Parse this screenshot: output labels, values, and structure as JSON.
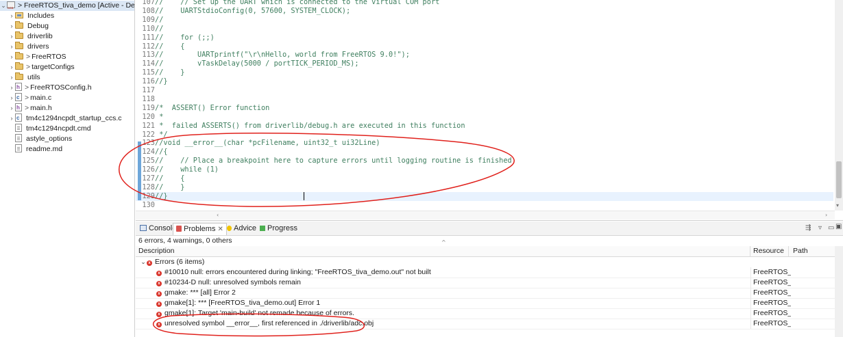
{
  "explorer": {
    "project": {
      "label": "> FreeRTOS_tiva_demo  [Active - Debug]"
    },
    "items": [
      {
        "twisty": "›",
        "icon": "library-icon",
        "prefix": "",
        "label": "Includes"
      },
      {
        "twisty": "›",
        "icon": "folder-icon",
        "prefix": "",
        "label": "Debug"
      },
      {
        "twisty": "›",
        "icon": "folder-icon",
        "prefix": "",
        "label": "driverlib"
      },
      {
        "twisty": "›",
        "icon": "folder-icon",
        "prefix": "",
        "label": "drivers"
      },
      {
        "twisty": "›",
        "icon": "folder-icon",
        "prefix": ">",
        "label": "FreeRTOS"
      },
      {
        "twisty": "›",
        "icon": "folder-icon",
        "prefix": ">",
        "label": "targetConfigs"
      },
      {
        "twisty": "›",
        "icon": "folder-icon",
        "prefix": "",
        "label": "utils"
      },
      {
        "twisty": "›",
        "icon": "header-file-icon",
        "prefix": ">",
        "label": "FreeRTOSConfig.h"
      },
      {
        "twisty": "›",
        "icon": "c-file-icon",
        "prefix": ">",
        "label": "main.c"
      },
      {
        "twisty": "›",
        "icon": "header-file-icon",
        "prefix": ">",
        "label": "main.h"
      },
      {
        "twisty": "›",
        "icon": "c-file-icon",
        "prefix": "",
        "label": "tm4c1294ncpdt_startup_ccs.c"
      },
      {
        "twisty": "",
        "icon": "file-icon",
        "prefix": "",
        "label": "tm4c1294ncpdt.cmd"
      },
      {
        "twisty": "",
        "icon": "file-icon",
        "prefix": "",
        "label": "astyle_options"
      },
      {
        "twisty": "",
        "icon": "file-icon",
        "prefix": "",
        "label": "readme.md"
      }
    ]
  },
  "editor": {
    "lines": [
      {
        "num": "107",
        "text": "//    // Set up the UART which is connected to the virtual COM port"
      },
      {
        "num": "108",
        "text": "//    UARTStdioConfig(0, 57600, SYSTEM_CLOCK);"
      },
      {
        "num": "109",
        "text": "//"
      },
      {
        "num": "110",
        "text": "//"
      },
      {
        "num": "111",
        "text": "//    for (;;)"
      },
      {
        "num": "112",
        "text": "//    {"
      },
      {
        "num": "113",
        "text": "//        UARTprintf(\"\\r\\nHello, world from FreeRTOS 9.0!\");"
      },
      {
        "num": "114",
        "text": "//        vTaskDelay(5000 / portTICK_PERIOD_MS);"
      },
      {
        "num": "115",
        "text": "//    }"
      },
      {
        "num": "116",
        "text": "//}"
      },
      {
        "num": "117",
        "text": ""
      },
      {
        "num": "118",
        "text": ""
      },
      {
        "num": "119",
        "text": "/*  ASSERT() Error function"
      },
      {
        "num": "120",
        "text": " *"
      },
      {
        "num": "121",
        "text": " *  failed ASSERTS() from driverlib/debug.h are executed in this function"
      },
      {
        "num": "122",
        "text": " */"
      },
      {
        "num": "123",
        "text": "//void __error__(char *pcFilename, uint32_t ui32Line)"
      },
      {
        "num": "124",
        "text": "//{"
      },
      {
        "num": "125",
        "text": "//    // Place a breakpoint here to capture errors until logging routine is finished"
      },
      {
        "num": "126",
        "text": "//    while (1)"
      },
      {
        "num": "127",
        "text": "//    {"
      },
      {
        "num": "128",
        "text": "//    }"
      },
      {
        "num": "129",
        "text": "//}"
      },
      {
        "num": "130",
        "text": ""
      }
    ]
  },
  "panel": {
    "tabs": [
      {
        "label": "Console",
        "icon": "console-icon"
      },
      {
        "label": "Problems",
        "icon": "problems-icon",
        "close": "✕"
      },
      {
        "label": "Advice",
        "icon": "advice-icon"
      },
      {
        "label": "Progress",
        "icon": "progress-icon"
      }
    ],
    "summary": "6 errors, 4 warnings, 0 others",
    "columns": {
      "description": "Description",
      "resource": "Resource",
      "path": "Path"
    },
    "group": {
      "label": "Errors (6 items)"
    },
    "rows": [
      {
        "description": "#10010 null: errors encountered during linking; \"FreeRTOS_tiva_demo.out\" not built",
        "resource": "FreeRTOS_t..."
      },
      {
        "description": "#10234-D null: unresolved symbols remain",
        "resource": "FreeRTOS_t..."
      },
      {
        "description": "gmake: *** [all] Error 2",
        "resource": "FreeRTOS_t..."
      },
      {
        "description": "gmake[1]: *** [FreeRTOS_tiva_demo.out] Error 1",
        "resource": "FreeRTOS_t..."
      },
      {
        "description": "gmake[1]: Target 'main-build' not remade because of errors.",
        "resource": "FreeRTOS_t..."
      },
      {
        "description": "unresolved symbol __error__, first referenced in ./driverlib/adc.obj",
        "resource": "FreeRTOS_t..."
      }
    ]
  },
  "colors": {
    "comment": "#3f7f5f",
    "annotation": "#e0201b",
    "error": "#d9342b",
    "selection": "#dbe7f5"
  }
}
